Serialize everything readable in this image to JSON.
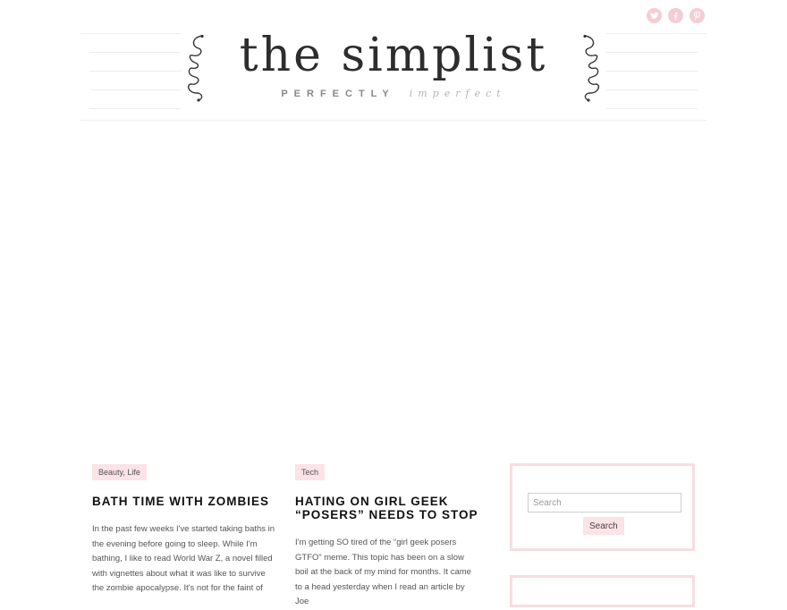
{
  "social": [
    {
      "name": "twitter-icon",
      "glyph": "t"
    },
    {
      "name": "facebook-icon",
      "glyph": "f"
    },
    {
      "name": "pinterest-icon",
      "glyph": "p"
    }
  ],
  "header": {
    "title": "the simplist",
    "tagline_bold": "PERFECTLY",
    "tagline_italic": "imperfect"
  },
  "posts": [
    {
      "category": "Beauty, Life",
      "title": "BATH TIME WITH ZOMBIES",
      "excerpt": "In the past few weeks I've started taking baths in the evening before going to sleep. While I'm bathing, I like to read World War Z, a novel filled with vignettes about what it was like to survive the zombie apocalypse. It's not for the faint of"
    },
    {
      "category": "Tech",
      "title": "HATING ON GIRL GEEK “POSERS” NEEDS TO STOP",
      "excerpt": "I'm getting SO tired of the “girl geek posers GTFO” meme. This topic has been on a slow boil at the back of my mind for months. It came to a head yesterday when I read an article by Joe"
    }
  ],
  "sidebar": {
    "search_placeholder": "Search",
    "search_button": "Search"
  },
  "colors": {
    "accent_pink": "#f4cdd3",
    "tag_pink": "#fbe3e6"
  }
}
